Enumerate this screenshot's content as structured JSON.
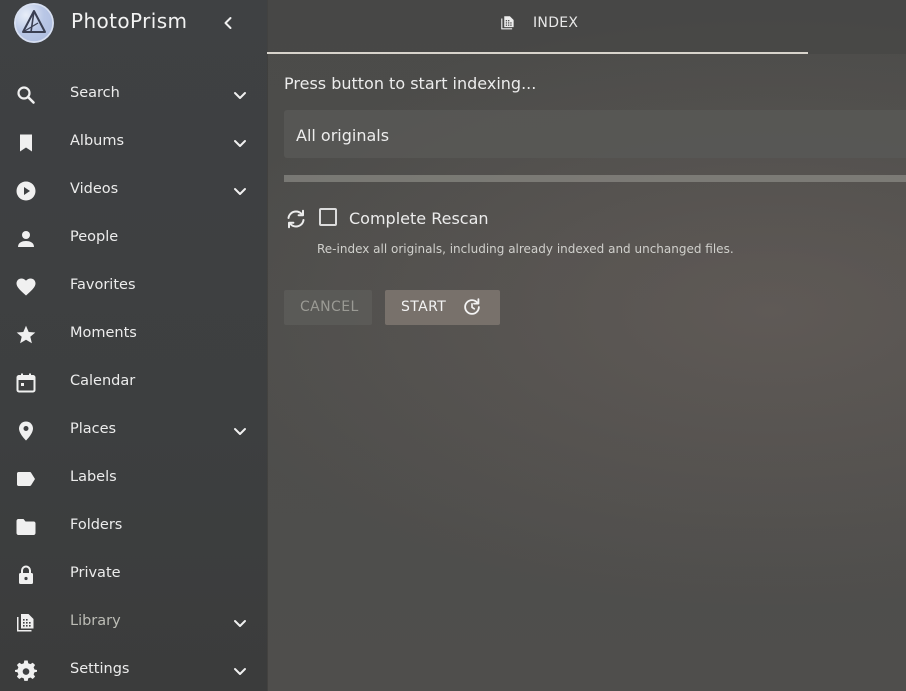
{
  "app": {
    "name": "PhotoPrism"
  },
  "sidebar": {
    "items": [
      {
        "label": "Search",
        "icon": "search-icon",
        "expandable": true
      },
      {
        "label": "Albums",
        "icon": "bookmark-icon",
        "expandable": true
      },
      {
        "label": "Videos",
        "icon": "play-circle-icon",
        "expandable": true
      },
      {
        "label": "People",
        "icon": "person-icon",
        "expandable": false
      },
      {
        "label": "Favorites",
        "icon": "heart-icon",
        "expandable": false
      },
      {
        "label": "Moments",
        "icon": "star-icon",
        "expandable": false
      },
      {
        "label": "Calendar",
        "icon": "calendar-icon",
        "expandable": false
      },
      {
        "label": "Places",
        "icon": "place-pin-icon",
        "expandable": true
      },
      {
        "label": "Labels",
        "icon": "label-icon",
        "expandable": false
      },
      {
        "label": "Folders",
        "icon": "folder-icon",
        "expandable": false
      },
      {
        "label": "Private",
        "icon": "lock-icon",
        "expandable": false
      },
      {
        "label": "Library",
        "icon": "photo-library-icon",
        "expandable": true,
        "active": true
      },
      {
        "label": "Settings",
        "icon": "gear-icon",
        "expandable": true
      }
    ]
  },
  "toolbar": {
    "tab_label": "INDEX",
    "tab_icon": "photo-library-icon"
  },
  "index": {
    "status": "Press button to start indexing...",
    "path_select": "All originals",
    "progress": 0,
    "complete_rescan_label": "Complete Rescan",
    "complete_rescan_checked": false,
    "hint": "Re-index all originals, including already indexed and unchanged files.",
    "cancel_label": "CANCEL",
    "start_label": "START"
  },
  "colors": {
    "sidebar_bg": "#3f4143",
    "start_button": "#78716b",
    "tab_indicator": "#d8d4cc"
  }
}
